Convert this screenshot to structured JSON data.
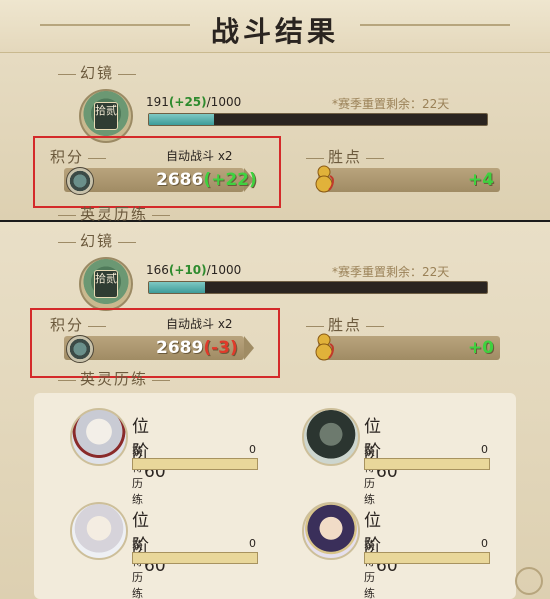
{
  "title": "战斗结果",
  "colors": {
    "accent_red": "#d42a2a",
    "gain_green": "#2e8b2e",
    "xp_fill": "#3d9c9a"
  },
  "top": {
    "mirror_label": "幻镜",
    "rank_badge": "拾贰",
    "xp_current": "191",
    "xp_gain": "(+25)",
    "xp_max": "/1000",
    "xp_progress": 0.191,
    "season": "*赛季重置剩余：22天",
    "score_label": "积分",
    "auto_battle": "自动战斗 x2",
    "score_value": "2686",
    "score_delta": "(+22)",
    "victory_label": "胜点",
    "victory_value": "+4",
    "hero_label": "英灵历练"
  },
  "bottom": {
    "mirror_label": "幻镜",
    "rank_badge": "拾贰",
    "xp_current": "166",
    "xp_gain": "(+10)",
    "xp_max": "/1000",
    "xp_progress": 0.166,
    "season": "*赛季重置剩余：22天",
    "score_label": "积分",
    "auto_battle": "自动战斗 x2",
    "score_value": "2689",
    "score_delta": "(-3)",
    "victory_label": "胜点",
    "victory_value": "+0",
    "hero_label": "英灵历练"
  },
  "heroes": [
    {
      "name_icon": "white-haired-hero-portrait",
      "rank_label": "位阶",
      "rank": "60",
      "xp_label": "获得历练",
      "xp_value": "0"
    },
    {
      "name_icon": "dark-bearded-hero-portrait",
      "rank_label": "位阶",
      "rank": "60",
      "xp_label": "获得历练",
      "xp_value": "0"
    },
    {
      "name_icon": "silver-haired-hero-portrait",
      "rank_label": "位阶",
      "rank": "60",
      "xp_label": "获得历练",
      "xp_value": "0"
    },
    {
      "name_icon": "purple-crowned-hero-portrait",
      "rank_label": "位阶",
      "rank": "60",
      "xp_label": "获得历练",
      "xp_value": "0"
    }
  ]
}
